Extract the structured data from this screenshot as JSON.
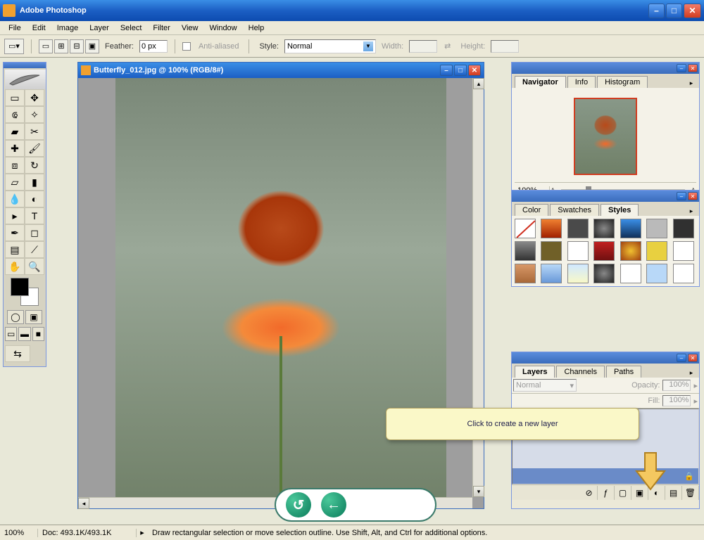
{
  "app": {
    "title": "Adobe Photoshop"
  },
  "menus": [
    "File",
    "Edit",
    "Image",
    "Layer",
    "Select",
    "Filter",
    "View",
    "Window",
    "Help"
  ],
  "options": {
    "feather_label": "Feather:",
    "feather_value": "0 px",
    "antialias_label": "Anti-aliased",
    "style_label": "Style:",
    "style_value": "Normal",
    "width_label": "Width:",
    "height_label": "Height:"
  },
  "document": {
    "title": "Butterfly_012.jpg @ 100% (RGB/8#)"
  },
  "navigator": {
    "tabs": [
      "Navigator",
      "Info",
      "Histogram"
    ],
    "zoom": "100%"
  },
  "styles": {
    "tabs": [
      "Color",
      "Swatches",
      "Styles"
    ],
    "swatches": [
      "#ffffff",
      "linear-gradient(#f08030,#a02000)",
      "#4a4a4a",
      "radial-gradient(#888,#222)",
      "linear-gradient(#3a8ee6,#10305a)",
      "#bababa",
      "#303030",
      "linear-gradient(#888,#333)",
      "#706028",
      "#ffffff",
      "linear-gradient(#c02020,#701010)",
      "radial-gradient(#f0c030,#a04010)",
      "#e8d040",
      "#ffffff",
      "linear-gradient(#d89868,#a86838)",
      "linear-gradient(#b8d8f8,#6898d8)",
      "linear-gradient(#d0e8ff,#f8f8c8)",
      "radial-gradient(#888,#222)",
      "#ffffff",
      "#b8d8f8",
      "#ffffff"
    ]
  },
  "layers": {
    "tabs": [
      "Layers",
      "Channels",
      "Paths"
    ],
    "blend_mode": "Normal",
    "opacity_label": "Opacity:",
    "opacity_value": "100%",
    "fill_label": "Fill:",
    "fill_value": "100%"
  },
  "tooltip": "Click to create a new layer",
  "status": {
    "zoom": "100%",
    "doc": "Doc: 493.1K/493.1K",
    "hint": "Draw rectangular selection or move selection outline.  Use Shift, Alt, and Ctrl for additional options."
  }
}
